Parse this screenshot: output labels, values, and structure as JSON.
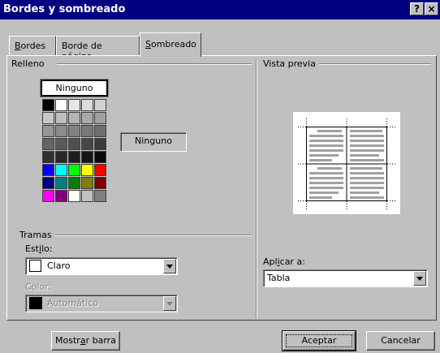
{
  "window": {
    "title": "Bordes y sombreado",
    "help_glyph": "?",
    "close_glyph": "×"
  },
  "tabs": [
    {
      "label_pre": "",
      "label_ul": "B",
      "label_post": "ordes",
      "active": false
    },
    {
      "label_pre": "Borde de ",
      "label_ul": "p",
      "label_post": "ágina",
      "active": false
    },
    {
      "label_pre": "",
      "label_ul": "S",
      "label_post": "ombreado",
      "active": true
    }
  ],
  "fill": {
    "group_label": "Relleno",
    "none_button": "Ninguno",
    "selected_display": "Ninguno",
    "palette": [
      [
        "#000000",
        "#ffffff",
        "#e6e6e6",
        "#dcdcdc",
        "#d2d2d2"
      ],
      [
        "#c8c8c8",
        "#bebebe",
        "#b4b4b4",
        "#aaaaaa",
        "#a0a0a0"
      ],
      [
        "#969696",
        "#8c8c8c",
        "#828282",
        "#787878",
        "#6e6e6e"
      ],
      [
        "#646464",
        "#5a5a5a",
        "#505050",
        "#464646",
        "#3c3c3c"
      ],
      [
        "#323232",
        "#282828",
        "#1e1e1e",
        "#141414",
        "#0a0a0a"
      ],
      [
        "#0000ff",
        "#00ffff",
        "#00ff00",
        "#ffff00",
        "#ff0000"
      ],
      [
        "#000080",
        "#008080",
        "#008000",
        "#808000",
        "#800000"
      ],
      [
        "#ff00ff",
        "#800080",
        "#ffffff",
        "#c0c0c0",
        "#808080"
      ]
    ]
  },
  "patterns": {
    "group_label": "Tramas",
    "style_label_pre": "Est",
    "style_label_ul": "i",
    "style_label_post": "lo:",
    "style_value": "Claro",
    "style_swatch_color": "#ffffff",
    "color_label": "Color:",
    "color_value": "Automático",
    "color_swatch_color": "#000000"
  },
  "preview": {
    "group_label": "Vista previa",
    "apply_label_pre": "Apl",
    "apply_label_ul": "i",
    "apply_label_post": "car a:",
    "apply_value": "Tabla"
  },
  "buttons": {
    "toolbar_pre": "Mostr",
    "toolbar_ul": "a",
    "toolbar_post": "r barra",
    "ok": "Aceptar",
    "cancel": "Cancelar"
  }
}
